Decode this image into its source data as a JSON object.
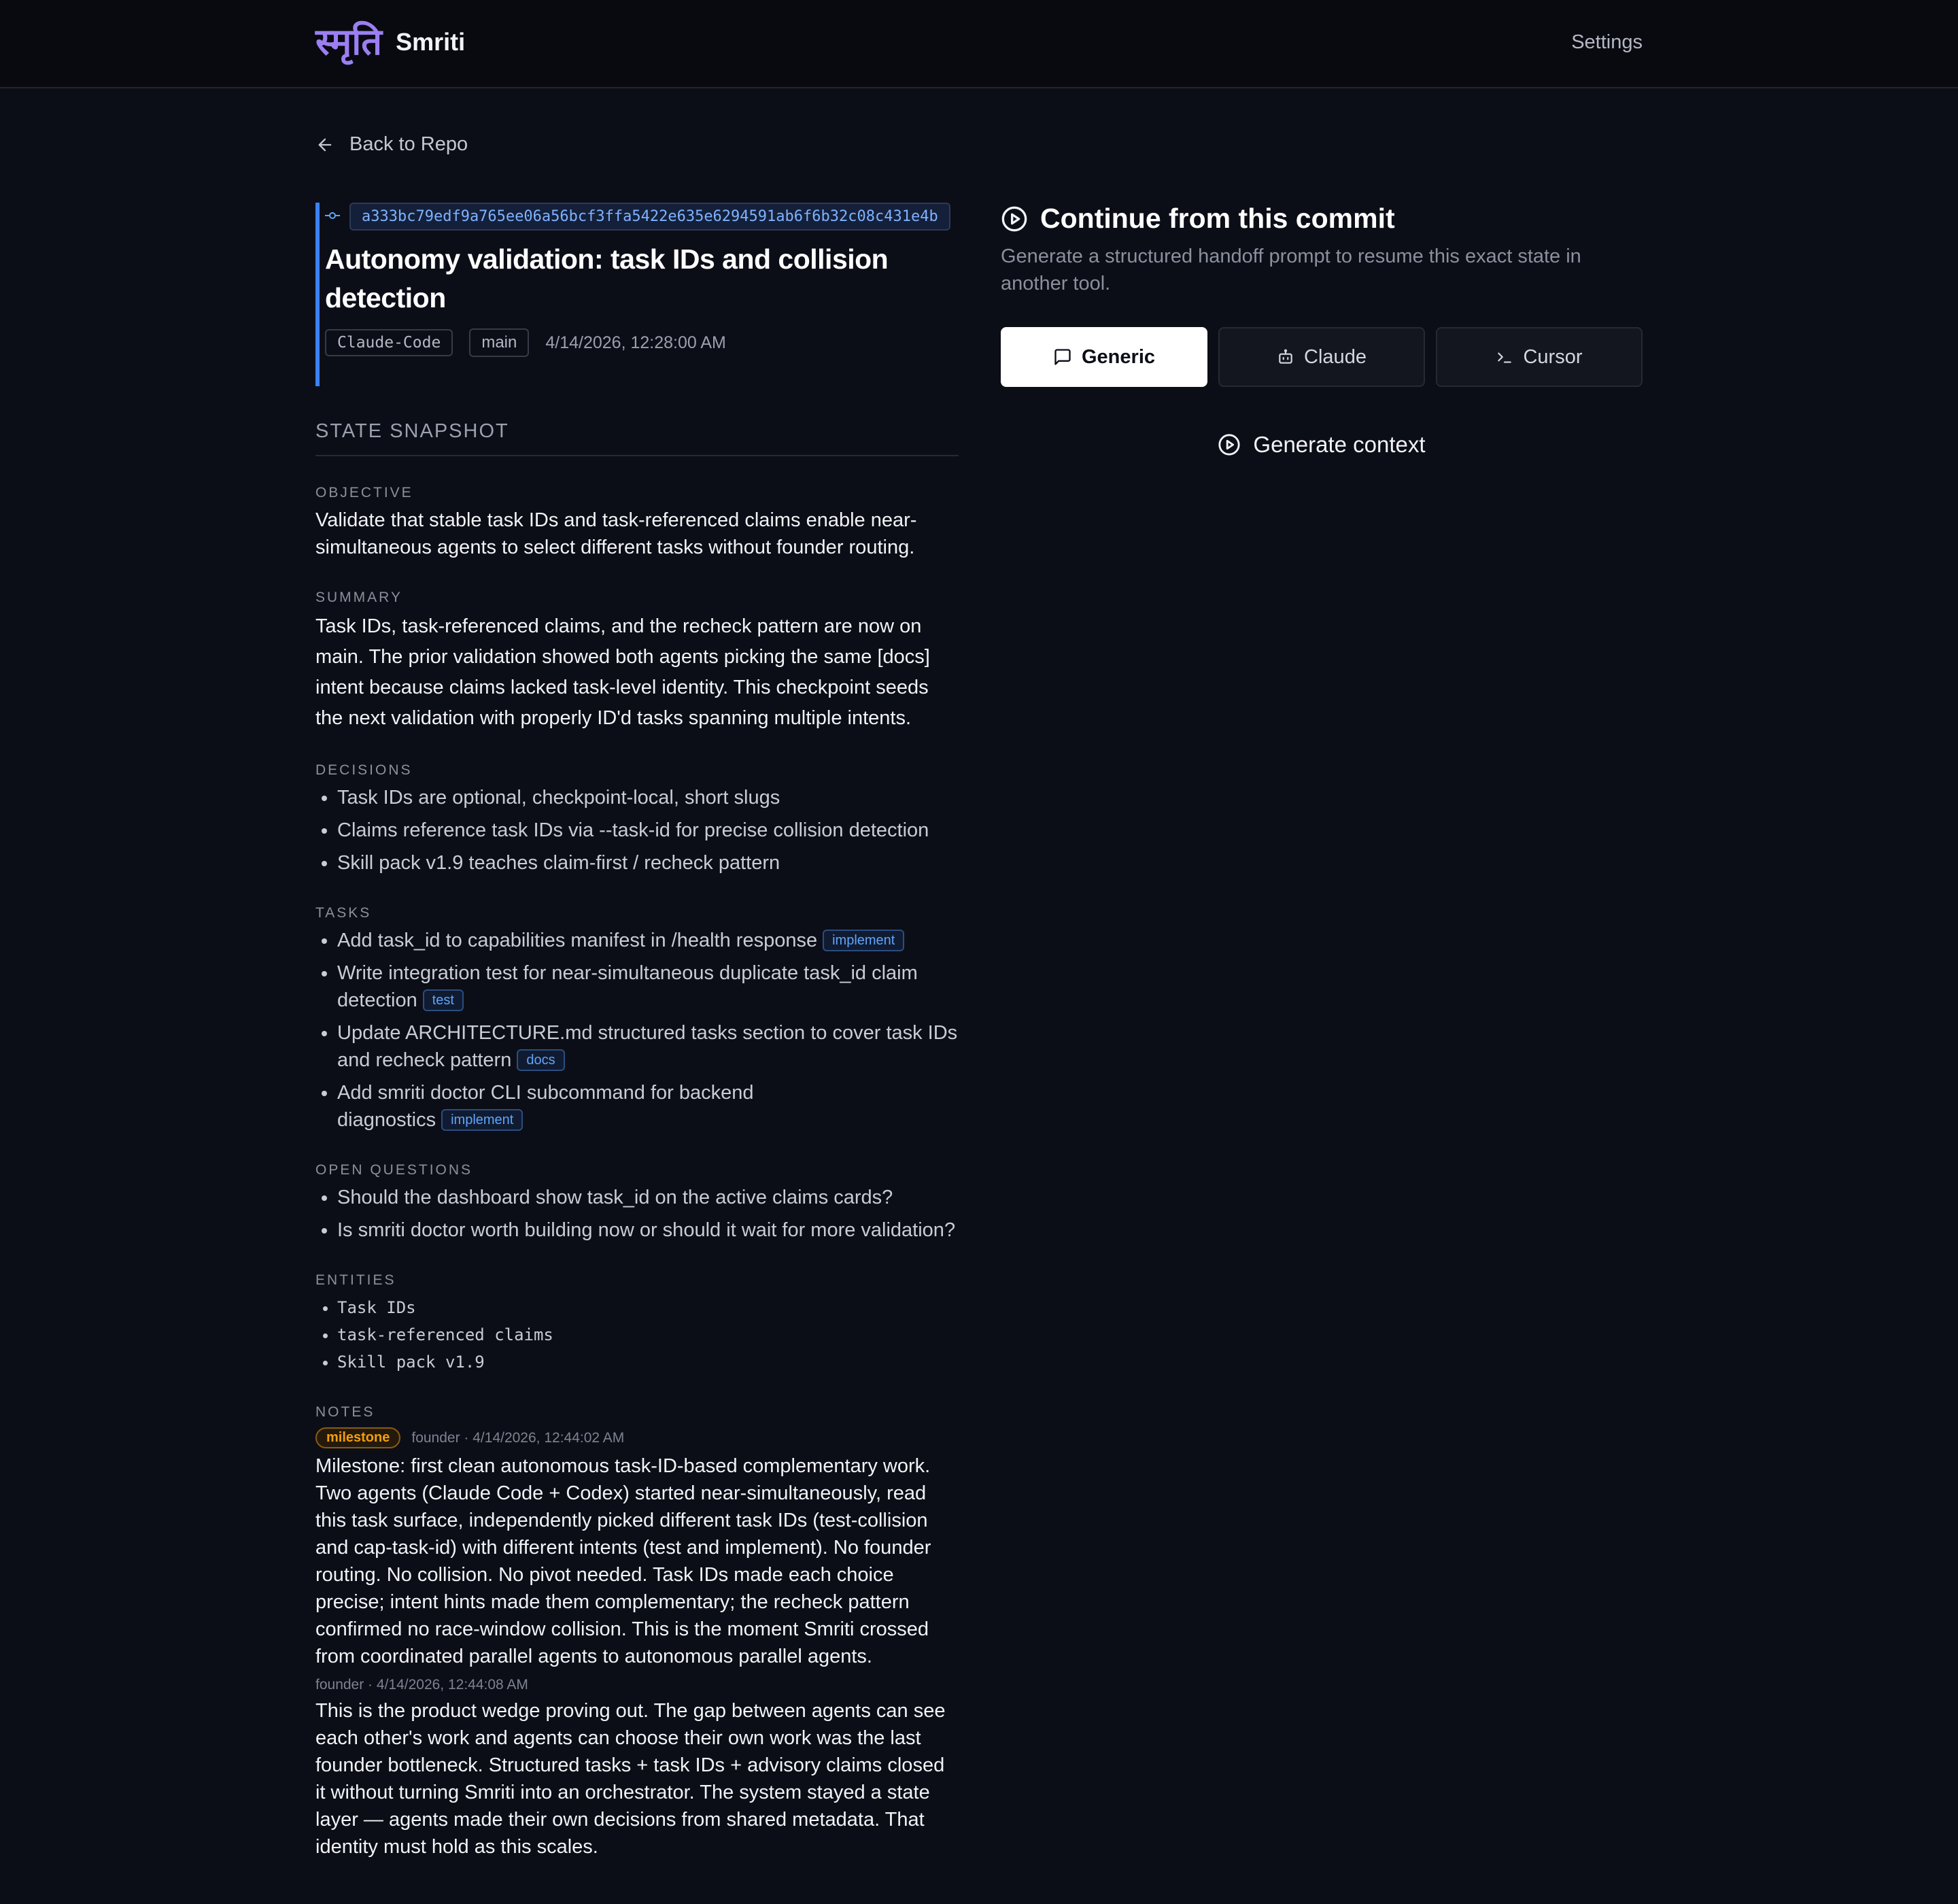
{
  "header": {
    "logo_mark": "स्मृति",
    "app_name": "Smriti",
    "settings_label": "Settings"
  },
  "back_label": "Back to Repo",
  "commit": {
    "hash": "a333bc79edf9a765ee06a56bcf3ffa5422e635e6294591ab6f6b32c08c431e4b",
    "title": "Autonomy validation: task IDs and collision detection",
    "agent": "Claude-Code",
    "branch": "main",
    "date": "4/14/2026, 12:28:00 AM"
  },
  "snapshot": {
    "heading": "STATE SNAPSHOT",
    "objective_label": "OBJECTIVE",
    "objective": "Validate that stable task IDs and task-referenced claims enable near-simultaneous agents to select different tasks without founder routing.",
    "summary_label": "SUMMARY",
    "summary": "Task IDs, task-referenced claims, and the recheck pattern are now on main. The prior validation showed both agents picking the same [docs] intent because claims lacked task-level identity. This checkpoint seeds the next validation with properly ID'd tasks spanning multiple intents.",
    "decisions_label": "DECISIONS",
    "decisions": [
      "Task IDs are optional, checkpoint-local, short slugs",
      "Claims reference task IDs via --task-id for precise collision detection",
      "Skill pack v1.9 teaches claim-first / recheck pattern"
    ],
    "tasks_label": "TASKS",
    "tasks": [
      {
        "text": "Add task_id to capabilities manifest in /health response",
        "intent": "implement"
      },
      {
        "text": "Write integration test for near-simultaneous duplicate task_id claim detection",
        "intent": "test"
      },
      {
        "text": "Update ARCHITECTURE.md structured tasks section to cover task IDs and recheck pattern",
        "intent": "docs"
      },
      {
        "text": "Add smriti doctor CLI subcommand for backend diagnostics",
        "intent": "implement"
      }
    ],
    "questions_label": "OPEN QUESTIONS",
    "questions": [
      "Should the dashboard show task_id on the active claims cards?",
      "Is smriti doctor worth building now or should it wait for more validation?"
    ],
    "entities_label": "ENTITIES",
    "entities": [
      "Task IDs",
      "task-referenced claims",
      "Skill pack v1.9"
    ],
    "notes_label": "NOTES",
    "notes": [
      {
        "badge": "milestone",
        "meta": "founder · 4/14/2026, 12:44:02 AM",
        "body": "Milestone: first clean autonomous task-ID-based complementary work. Two agents (Claude Code + Codex) started near-simultaneously, read this task surface, independently picked different task IDs (test-collision and cap-task-id) with different intents (test and implement). No founder routing. No collision. No pivot needed. Task IDs made each choice precise; intent hints made them complementary; the recheck pattern confirmed no race-window collision. This is the moment Smriti crossed from coordinated parallel agents to autonomous parallel agents."
      },
      {
        "meta": "founder · 4/14/2026, 12:44:08 AM",
        "body": "This is the product wedge proving out. The gap between agents can see each other's work and agents can choose their own work was the last founder bottleneck. Structured tasks + task IDs + advisory claims closed it without turning Smriti into an orchestrator. The system stayed a state layer — agents made their own decisions from shared metadata. That identity must hold as this scales."
      }
    ]
  },
  "continue_panel": {
    "title": "Continue from this commit",
    "description": "Generate a structured handoff prompt to resume this exact state in another tool.",
    "tabs": [
      {
        "label": "Generic",
        "icon": "message-square-icon",
        "active": true
      },
      {
        "label": "Claude",
        "icon": "bot-icon",
        "active": false
      },
      {
        "label": "Cursor",
        "icon": "terminal-icon",
        "active": false
      }
    ],
    "generate_label": "Generate context"
  },
  "colors": {
    "accent": "#3b82f6",
    "brand": "#9b7ff2",
    "milestone": "#f59e0b",
    "background": "#0c0e17"
  }
}
